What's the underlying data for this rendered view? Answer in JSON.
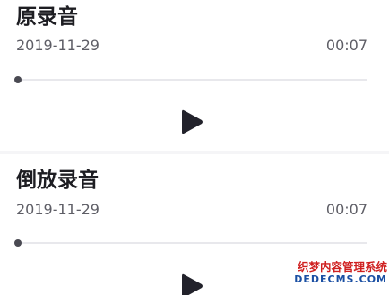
{
  "recordings": [
    {
      "title": "原录音",
      "date": "2019-11-29",
      "duration": "00:07",
      "progress": 0,
      "play_icon": "play-icon"
    },
    {
      "title": "倒放录音",
      "date": "2019-11-29",
      "duration": "00:07",
      "progress": 0,
      "play_icon": "play-icon"
    }
  ],
  "watermark": {
    "line1": "织梦内容管理系统",
    "line2": "DEDECMS.COM"
  },
  "colors": {
    "title": "#1d1d22",
    "meta_text": "#5e5e66",
    "track": "#e8e8ec",
    "knob": "#4a4a52",
    "play": "#22222b",
    "divider": "#f5f5f7",
    "watermark_red": "#cf1f1f",
    "watermark_blue": "#1a4fa3"
  }
}
